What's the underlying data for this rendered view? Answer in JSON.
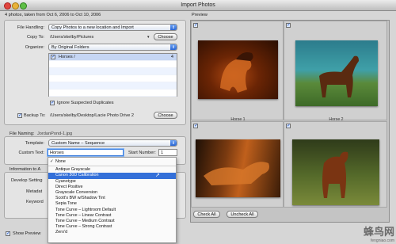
{
  "window": {
    "title": "Import Photos"
  },
  "photo_count": "4 photos, taken from Oct 6, 2006 to Oct 10, 2006",
  "preview_label": "Preview",
  "file_handling": {
    "label": "File Handling:",
    "value": "Copy Photos to a new location and Import"
  },
  "copy_to": {
    "label": "Copy To:",
    "path": "/Users/skelby/Pictures",
    "button": "Choose"
  },
  "organize": {
    "label": "Organize:",
    "value": "By Original Folders"
  },
  "folders": [
    {
      "name": "Horses /",
      "count": "4"
    }
  ],
  "ignore_duplicates": {
    "label": "Ignore Suspected Duplicates",
    "checked": true
  },
  "backup": {
    "label": "Backup To:",
    "path": "/Users/skelby/Desktop/Lacie Photo Drive 2",
    "button": "Choose"
  },
  "file_naming": {
    "label": "File Naming:",
    "example": "JordanPond-1.jpg"
  },
  "template": {
    "label": "Template:",
    "value": "Custom Name – Sequence"
  },
  "custom_text": {
    "label": "Custom Text:",
    "value": "Horses"
  },
  "start_number": {
    "label": "Start Number:",
    "value": "1"
  },
  "info_section": {
    "label": "Information to A"
  },
  "develop_settings": {
    "label": "Develop Setting"
  },
  "metadata": {
    "label": "Metadat"
  },
  "keywords": {
    "label": "Keyword"
  },
  "show_preview": {
    "label": "Show Preview",
    "checked": true
  },
  "dropdown": {
    "items": [
      {
        "label": "None",
        "checked": true
      },
      {
        "label": "Antique Grayscale"
      },
      {
        "label": "Canon 30D Calibration",
        "selected": true
      },
      {
        "label": "Cyanotype"
      },
      {
        "label": "Direct Positive"
      },
      {
        "label": "Grayscale Conversion"
      },
      {
        "label": "Scott's BW w/Shadow Tint"
      },
      {
        "label": "Sepia Tone"
      },
      {
        "label": "Tone Curve – Lightroom Default"
      },
      {
        "label": "Tone Curve – Linear Contrast"
      },
      {
        "label": "Tone Curve – Medium Contrast"
      },
      {
        "label": "Tone Curve – Strong Contrast"
      },
      {
        "label": "Zero'd"
      }
    ]
  },
  "thumbnails": [
    {
      "caption": "Horse 1",
      "checked": true
    },
    {
      "caption": "Horse 2",
      "checked": true
    },
    {
      "caption": "",
      "checked": true
    },
    {
      "caption": "",
      "checked": true
    }
  ],
  "buttons": {
    "check_all": "Check All",
    "uncheck_all": "Uncheck All"
  },
  "watermark": {
    "text": "蜂鸟网",
    "url": "fengniao.com"
  },
  "colors": {
    "selection": "#3470d9",
    "background": "#d6d6d6"
  }
}
